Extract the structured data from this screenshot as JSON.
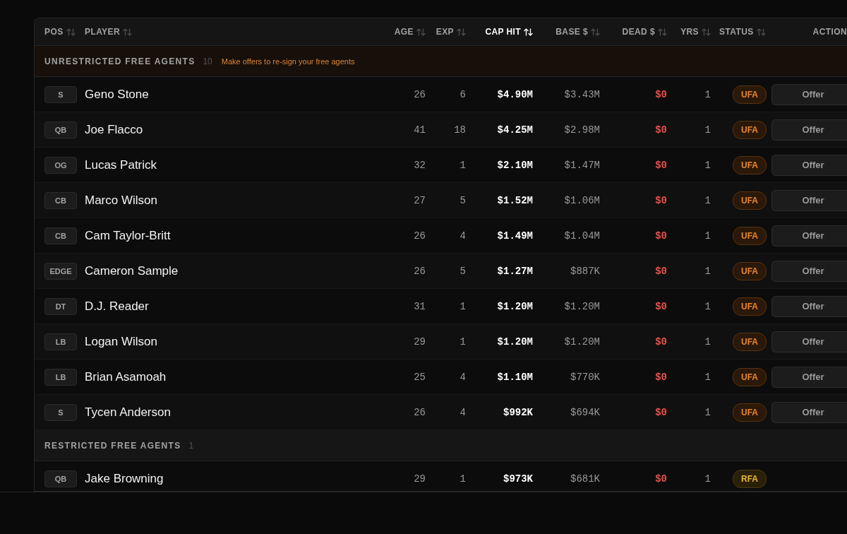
{
  "table": {
    "columns": [
      {
        "label": "POS",
        "sortable": true,
        "sorted": false
      },
      {
        "label": "PLAYER",
        "sortable": true,
        "sorted": false
      },
      {
        "label": "AGE",
        "sortable": true,
        "sorted": false
      },
      {
        "label": "EXP",
        "sortable": true,
        "sorted": false
      },
      {
        "label": "CAP HIT",
        "sortable": true,
        "sorted": true
      },
      {
        "label": "BASE $",
        "sortable": true,
        "sorted": false
      },
      {
        "label": "DEAD $",
        "sortable": true,
        "sorted": false
      },
      {
        "label": "YRS",
        "sortable": true,
        "sorted": false
      },
      {
        "label": "STATUS",
        "sortable": true,
        "sorted": false
      },
      {
        "label": "ACTION",
        "sortable": false,
        "sorted": false
      }
    ],
    "groups": [
      {
        "title": "UNRESTRICTED FREE AGENTS",
        "count": "10",
        "kind": "unrestricted",
        "note": "Make offers to re-sign your free agents",
        "rows": [
          {
            "pos": "S",
            "player": "Geno Stone",
            "age": "26",
            "exp": "6",
            "cap_hit": "$4.90M",
            "base": "$3.43M",
            "dead": "$0",
            "yrs": "1",
            "status": "UFA",
            "action": "Offer"
          },
          {
            "pos": "QB",
            "player": "Joe Flacco",
            "age": "41",
            "exp": "18",
            "cap_hit": "$4.25M",
            "base": "$2.98M",
            "dead": "$0",
            "yrs": "1",
            "status": "UFA",
            "action": "Offer"
          },
          {
            "pos": "OG",
            "player": "Lucas Patrick",
            "age": "32",
            "exp": "1",
            "cap_hit": "$2.10M",
            "base": "$1.47M",
            "dead": "$0",
            "yrs": "1",
            "status": "UFA",
            "action": "Offer"
          },
          {
            "pos": "CB",
            "player": "Marco Wilson",
            "age": "27",
            "exp": "5",
            "cap_hit": "$1.52M",
            "base": "$1.06M",
            "dead": "$0",
            "yrs": "1",
            "status": "UFA",
            "action": "Offer"
          },
          {
            "pos": "CB",
            "player": "Cam Taylor-Britt",
            "age": "26",
            "exp": "4",
            "cap_hit": "$1.49M",
            "base": "$1.04M",
            "dead": "$0",
            "yrs": "1",
            "status": "UFA",
            "action": "Offer"
          },
          {
            "pos": "EDGE",
            "player": "Cameron Sample",
            "age": "26",
            "exp": "5",
            "cap_hit": "$1.27M",
            "base": "$887K",
            "dead": "$0",
            "yrs": "1",
            "status": "UFA",
            "action": "Offer"
          },
          {
            "pos": "DT",
            "player": "D.J. Reader",
            "age": "31",
            "exp": "1",
            "cap_hit": "$1.20M",
            "base": "$1.20M",
            "dead": "$0",
            "yrs": "1",
            "status": "UFA",
            "action": "Offer"
          },
          {
            "pos": "LB",
            "player": "Logan Wilson",
            "age": "29",
            "exp": "1",
            "cap_hit": "$1.20M",
            "base": "$1.20M",
            "dead": "$0",
            "yrs": "1",
            "status": "UFA",
            "action": "Offer"
          },
          {
            "pos": "LB",
            "player": "Brian Asamoah",
            "age": "25",
            "exp": "4",
            "cap_hit": "$1.10M",
            "base": "$770K",
            "dead": "$0",
            "yrs": "1",
            "status": "UFA",
            "action": "Offer"
          },
          {
            "pos": "S",
            "player": "Tycen Anderson",
            "age": "26",
            "exp": "4",
            "cap_hit": "$992K",
            "base": "$694K",
            "dead": "$0",
            "yrs": "1",
            "status": "UFA",
            "action": "Offer"
          }
        ]
      },
      {
        "title": "RESTRICTED FREE AGENTS",
        "count": "1",
        "kind": "restricted",
        "rows": [
          {
            "pos": "QB",
            "player": "Jake Browning",
            "age": "29",
            "exp": "1",
            "cap_hit": "$973K",
            "base": "$681K",
            "dead": "$0",
            "yrs": "1",
            "status": "RFA"
          }
        ]
      }
    ]
  }
}
